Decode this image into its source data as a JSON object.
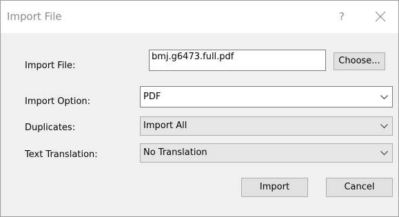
{
  "window": {
    "title": "Import File",
    "help_label": "?"
  },
  "form": {
    "import_file": {
      "label": "Import File:",
      "value": "bmj.g6473.full.pdf",
      "choose_label": "Choose..."
    },
    "import_option": {
      "label": "Import Option:",
      "value": "PDF"
    },
    "duplicates": {
      "label": "Duplicates:",
      "value": "Import All"
    },
    "text_translation": {
      "label": "Text Translation:",
      "value": "No Translation"
    }
  },
  "buttons": {
    "import_label": "Import",
    "cancel_label": "Cancel"
  },
  "icons": {
    "close": "close-icon",
    "dropdown": "chevron-down-icon"
  }
}
